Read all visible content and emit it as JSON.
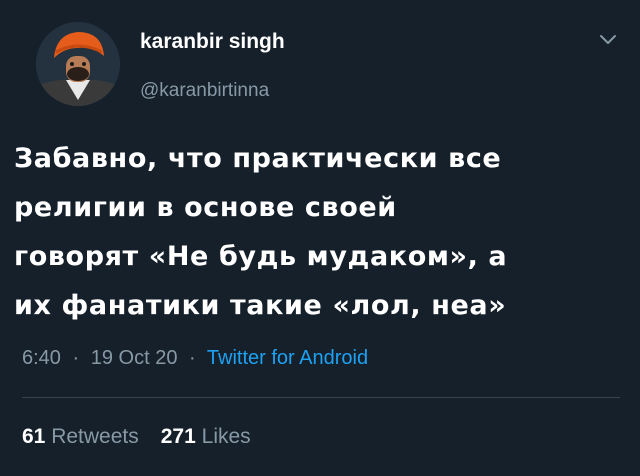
{
  "user": {
    "display_name": "karanbir singh",
    "handle": "@karanbirtinna"
  },
  "tweet": {
    "lines": [
      "Забавно, что практически все",
      "религии в основе своей",
      "говорят «Не будь мудаком», а",
      "их фанатики такие «лол, неа»"
    ]
  },
  "meta": {
    "time": "6:40",
    "separator": "·",
    "date": "19 Oct 20",
    "source": "Twitter for Android"
  },
  "stats": {
    "retweets_count": "61",
    "retweets_label": "Retweets",
    "likes_count": "271",
    "likes_label": "Likes"
  },
  "colors": {
    "background": "#15202b",
    "secondary_text": "#8899a6",
    "link": "#1da1f2",
    "divider": "#38444d"
  },
  "icons": {
    "menu": "chevron-down-icon"
  }
}
